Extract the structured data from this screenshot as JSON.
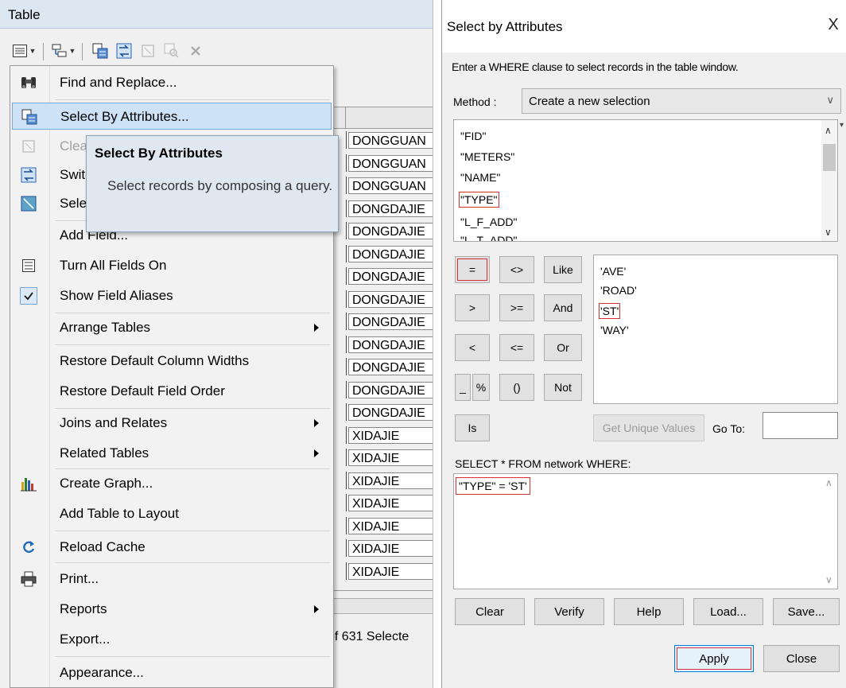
{
  "table_window": {
    "title": "Table",
    "toolbar": [
      "table-options-icon",
      "related-tables-icon",
      "select-by-attributes-icon",
      "switch-selection-icon",
      "clear-selection-icon",
      "zoom-selected-icon",
      "delete-selected-icon"
    ]
  },
  "grid_rows": [
    "DONGGUAN",
    "DONGGUAN",
    "DONGGUAN",
    "DONGDAJIE",
    "DONGDAJIE",
    "DONGDAJIE",
    "DONGDAJIE",
    "DONGDAJIE",
    "DONGDAJIE",
    "DONGDAJIE",
    "DONGDAJIE",
    "DONGDAJIE",
    "DONGDAJIE",
    "XIDAJIE",
    "XIDAJIE",
    "XIDAJIE",
    "XIDAJIE",
    "XIDAJIE",
    "XIDAJIE",
    "XIDAJIE"
  ],
  "status_text": "of 631 Selecte",
  "menu": {
    "items": [
      {
        "label": "Find and Replace...",
        "icon": "binoculars-icon"
      },
      {
        "label": "Select By Attributes...",
        "icon": "select-by-attributes-icon"
      },
      {
        "label": "Clear Selection",
        "icon": "clear-selection-icon"
      },
      {
        "label": "Switch Selection",
        "icon": "switch-selection-icon"
      },
      {
        "label": "Select All",
        "icon": "select-all-icon"
      },
      {
        "label": "Add Field...",
        "icon": ""
      },
      {
        "label": "Turn All Fields On",
        "icon": "fields-list-icon"
      },
      {
        "label": "Show Field Aliases",
        "icon": "checkmark-icon"
      },
      {
        "label": "Arrange Tables",
        "icon": ""
      },
      {
        "label": "Restore Default Column Widths",
        "icon": ""
      },
      {
        "label": "Restore Default Field Order",
        "icon": ""
      },
      {
        "label": "Joins and Relates",
        "icon": ""
      },
      {
        "label": "Related Tables",
        "icon": ""
      },
      {
        "label": "Create Graph...",
        "icon": "bar-graph-icon"
      },
      {
        "label": "Add Table to Layout",
        "icon": ""
      },
      {
        "label": "Reload Cache",
        "icon": "refresh-icon"
      },
      {
        "label": "Print...",
        "icon": "printer-icon"
      },
      {
        "label": "Reports",
        "icon": ""
      },
      {
        "label": "Export...",
        "icon": ""
      },
      {
        "label": "Appearance...",
        "icon": ""
      }
    ]
  },
  "tooltip": {
    "title": "Select By Attributes",
    "body": "Select records by composing a query."
  },
  "dialog": {
    "title": "Select by Attributes",
    "close": "X",
    "instructions": "Enter a WHERE clause to select records in the table window.",
    "method_label": "Method :",
    "method_value": "Create a new selection",
    "fields": [
      "\"FID\"",
      "\"METERS\"",
      "\"NAME\"",
      "\"TYPE\"",
      "\"L_F_ADD\"",
      "\"L_T_ADD\""
    ],
    "operators": [
      "=",
      "<>",
      "Like",
      ">",
      ">=",
      "And",
      "<",
      "<=",
      "Or",
      "_",
      "%",
      "()",
      "Not",
      "Is"
    ],
    "values": [
      "'AVE'",
      "'ROAD'",
      "'ST'",
      "'WAY'"
    ],
    "unique_values_label": "Get Unique Values",
    "goto_label": "Go To:",
    "goto_value": "",
    "sql_label": "SELECT * FROM network WHERE:",
    "sql_text": "\"TYPE\" = 'ST'",
    "buttons": {
      "clear": "Clear",
      "verify": "Verify",
      "help": "Help",
      "load": "Load...",
      "save": "Save...",
      "apply": "Apply",
      "close": "Close"
    }
  }
}
